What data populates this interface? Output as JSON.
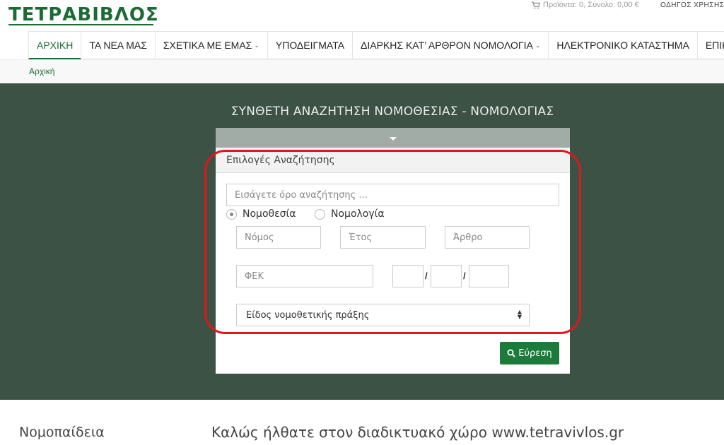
{
  "header": {
    "logo": "ΤΕΤΡΑΒΙΒΛΟΣ",
    "cart_text": "Προϊόντα: 0, Σύνολο: 0,00 €",
    "guide": "ΟΔΗΓΟΣ ΧΡΗΣΗΣ"
  },
  "nav": {
    "items": [
      {
        "label": "ΑΡΧΙΚΗ",
        "active": true
      },
      {
        "label": "ΤΑ ΝΕΑ ΜΑΣ"
      },
      {
        "label": "ΣΧΕΤΙΚΑ ΜΕ ΕΜΑΣ",
        "caret": "⌄"
      },
      {
        "label": "ΥΠΟΔΕΙΓΜΑΤΑ"
      },
      {
        "label": "ΔΙΑΡΚΗΣ ΚΑΤ’ ΑΡΘΡΟΝ ΝΟΜΟΛΟΓΙΑ",
        "caret": "⌄"
      },
      {
        "label": "ΗΛΕΚΤΡΟΝΙΚΟ ΚΑΤΑΣΤΗΜΑ"
      },
      {
        "label": "ΕΠΙΚΟ"
      }
    ]
  },
  "breadcrumb": "Αρχική",
  "hero": {
    "title": "ΣΥΝΘΕΤΗ ΑΝΑΖΗΤΗΣΗ ΝΟΜΟΘΕΣΙΑΣ - ΝΟΜΟΛΟΓΙΑΣ"
  },
  "search": {
    "options_heading": "Επιλογές Αναζήτησης",
    "term_placeholder": "Εισάγετε όρο αναζήτησης ...",
    "radio_legislation": "Νομοθεσία",
    "radio_caselaw": "Νομολογία",
    "selected": "Νομοθεσία",
    "law_placeholder": "Νόμος",
    "year_placeholder": "Έτος",
    "article_placeholder": "Άρθρο",
    "fek_placeholder": "ΦΕΚ",
    "date_separator": "/",
    "act_type_selected": "Είδος νομοθετικής πράξης",
    "find_button": "Εύρεση"
  },
  "bottom": {
    "left_heading": "Νομοπαίδεια",
    "welcome": "Καλώς ήλθατε στον διαδικτυακό χώρο www.tetravivlos.gr"
  },
  "colors": {
    "brand_green": "#1c6b35",
    "hero_bg": "#3b5245",
    "highlight_red": "#e0161c"
  }
}
